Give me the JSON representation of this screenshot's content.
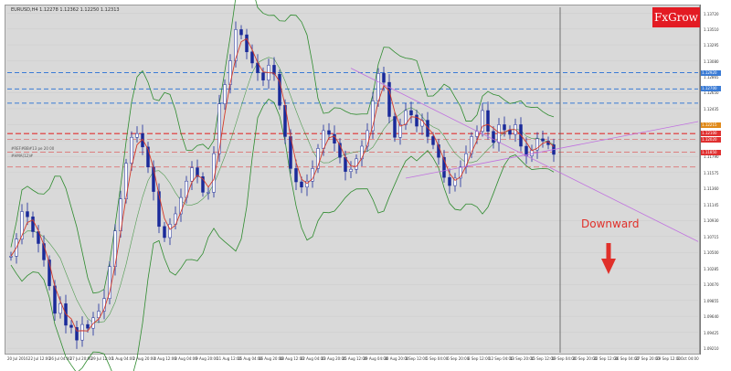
{
  "window": {
    "symbol_title": "EURUSD,H4  1.12278  1.12362  1.12250  1.12313",
    "indicator_lines": [
      "#REF#BB#13 pe 20 00",
      "#HMA(12)#"
    ]
  },
  "brand": {
    "logo_text": "FxGrow",
    "logo_color": "#e31b23"
  },
  "annotation": {
    "forecast_label": "Downward",
    "color": "#e0302a"
  },
  "colors": {
    "bull_candle": "#1a2a9a",
    "bear_candle": "#1a2a9a",
    "bollinger": "#2e8b2e",
    "moving_average": "#d43a2a",
    "resistance_lines": "#3a7bd5",
    "support_lines": "#e03030",
    "trend_line": "#c070e0",
    "chart_background": "#d9d9d9"
  },
  "chart_data": {
    "type": "candlestick",
    "instrument": "EURUSD",
    "timeframe": "H4",
    "x_ticks": [
      "20 Jul 2016",
      "22 Jul 12:00",
      "26 Jul 04:00",
      "27 Jul 20:00",
      "29 Jul 12:00",
      "1 Aug 04:00",
      "2 Aug 20:00",
      "4 Aug 12:00",
      "8 Aug 04:00",
      "9 Aug 20:00",
      "11 Aug 12:00",
      "15 Aug 04:00",
      "16 Aug 20:00",
      "18 Aug 12:00",
      "22 Aug 04:00",
      "23 Aug 20:00",
      "25 Aug 12:00",
      "29 Aug 04:00",
      "30 Aug 20:00",
      "1 Sep 12:00",
      "5 Sep 04:00",
      "6 Sep 20:00",
      "8 Sep 12:00",
      "12 Sep 04:00",
      "13 Sep 20:00",
      "15 Sep 12:00",
      "19 Sep 04:00",
      "20 Sep 20:00",
      "22 Sep 12:00",
      "26 Sep 04:00",
      "27 Sep 20:00",
      "29 Sep 12:00",
      "3 Oct 04:00"
    ],
    "y_ticks": [
      "1.13720",
      "1.13510",
      "1.13295",
      "1.13080",
      "1.12865",
      "1.12650",
      "1.12435",
      "1.12220",
      "1.12005",
      "1.11790",
      "1.11575",
      "1.11360",
      "1.11145",
      "1.10930",
      "1.10715",
      "1.10500",
      "1.10285",
      "1.10070",
      "1.09855",
      "1.09640",
      "1.09425",
      "1.09210"
    ],
    "ylim": [
      1.0915,
      1.138
    ],
    "close_path": [
      1.1045,
      1.1068,
      1.1105,
      1.1098,
      1.1078,
      1.1062,
      1.104,
      1.1005,
      1.0968,
      1.0981,
      1.0952,
      1.0949,
      1.0932,
      1.0953,
      1.0948,
      1.0962,
      1.0971,
      1.0988,
      1.1031,
      1.1079,
      1.1122,
      1.117,
      1.1205,
      1.121,
      1.1192,
      1.1165,
      1.1132,
      1.1085,
      1.107,
      1.1088,
      1.1102,
      1.1124,
      1.1146,
      1.1164,
      1.1152,
      1.1131,
      1.1131,
      1.1183,
      1.125,
      1.1276,
      1.1308,
      1.135,
      1.1343,
      1.132,
      1.1305,
      1.1292,
      1.1282,
      1.1302,
      1.129,
      1.1248,
      1.1206,
      1.1163,
      1.1145,
      1.1138,
      1.1146,
      1.1163,
      1.119,
      1.1214,
      1.1209,
      1.1197,
      1.1178,
      1.1159,
      1.1162,
      1.1176,
      1.1193,
      1.1214,
      1.1254,
      1.1291,
      1.1279,
      1.1233,
      1.1205,
      1.1222,
      1.1241,
      1.1235,
      1.122,
      1.1228,
      1.1206,
      1.1195,
      1.1178,
      1.1151,
      1.114,
      1.115,
      1.1165,
      1.1183,
      1.1206,
      1.1213,
      1.1241,
      1.1213,
      1.1198,
      1.1222,
      1.1215,
      1.1209,
      1.1222,
      1.1193,
      1.118,
      1.1188,
      1.1203,
      1.12,
      1.1195,
      1.1182
    ],
    "horizontal_levels": {
      "resistance": [
        1.1292,
        1.127,
        1.1251
      ],
      "support": [
        1.121,
        1.1202,
        1.1185,
        1.1165
      ],
      "current": 1.12215
    },
    "trend_lines": [
      {
        "from": [
          62,
          1.1298
        ],
        "to": [
          100,
          1.1158
        ],
        "extend": true
      },
      {
        "from": [
          72,
          1.115
        ],
        "to": [
          100,
          1.119
        ],
        "extend": true
      }
    ],
    "price_tags": [
      {
        "value": "1.12920",
        "color": "#3a7bd5"
      },
      {
        "value": "1.12700",
        "color": "#3a7bd5"
      },
      {
        "value": "1.12215",
        "color": "#e08a1a"
      },
      {
        "value": "1.12100",
        "color": "#e03030"
      },
      {
        "value": "1.12020",
        "color": "#e03030"
      },
      {
        "value": "1.11850",
        "color": "#e03030"
      }
    ]
  }
}
